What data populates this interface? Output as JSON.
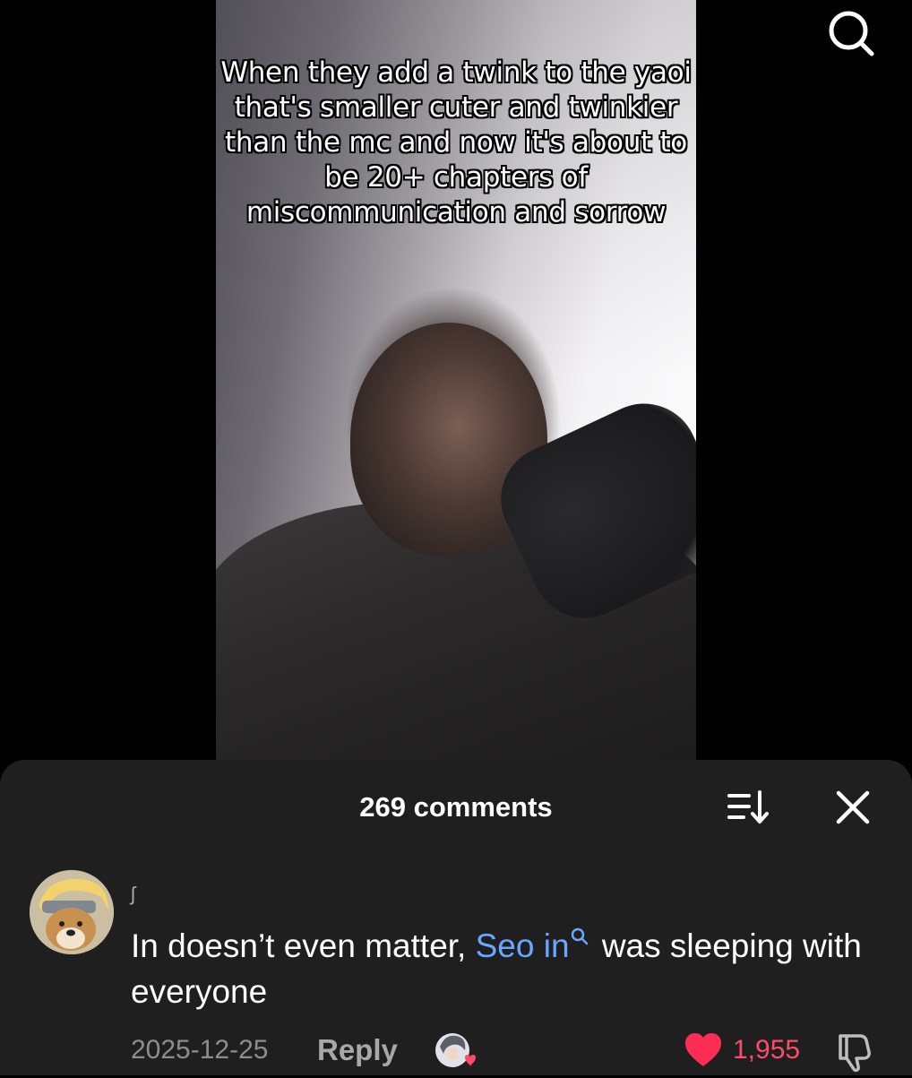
{
  "video": {
    "caption": "When they add a twink to the yaoi that's smaller cuter and twinkier than the mc and now it's about to be 20+ chapters of miscommunication and sorrow"
  },
  "comments_sheet": {
    "count_label": "269 comments",
    "background_color": "#1f1f1f"
  },
  "comment": {
    "username": "ʃ",
    "text_before": "In doesn’t even matter, ",
    "mention": "Seo in",
    "text_after": " was sleeping with everyone",
    "date": "2025-12-25",
    "reply_label": "Reply",
    "like_count": "1,955",
    "mention_color": "#6ba6ff",
    "like_color": "#ff4b6a"
  },
  "icons": {
    "search": "search-icon",
    "sort": "sort-icon",
    "close": "close-icon",
    "like": "heart-icon",
    "dislike": "thumbs-down-icon"
  }
}
